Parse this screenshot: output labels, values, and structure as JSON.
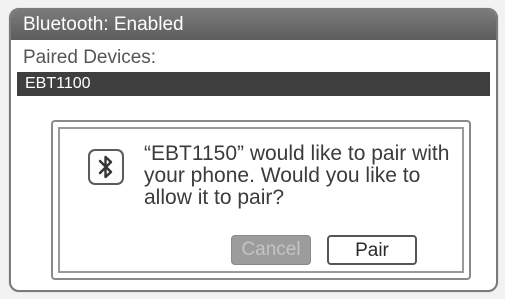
{
  "status_bar": {
    "title": "Bluetooth: Enabled"
  },
  "paired": {
    "label": "Paired Devices:",
    "devices": [
      {
        "name": "EBT1100"
      }
    ]
  },
  "dialog": {
    "icon": "bluetooth-icon",
    "message": "“EBT1150” would like to pair with your phone. Would you like to allow it to pair?",
    "cancel_label": "Cancel",
    "pair_label": "Pair"
  },
  "colors": {
    "status_bar": "#6b6b6b",
    "selected_row": "#3f3f3f",
    "button_disabled": "#9c9c9c"
  }
}
